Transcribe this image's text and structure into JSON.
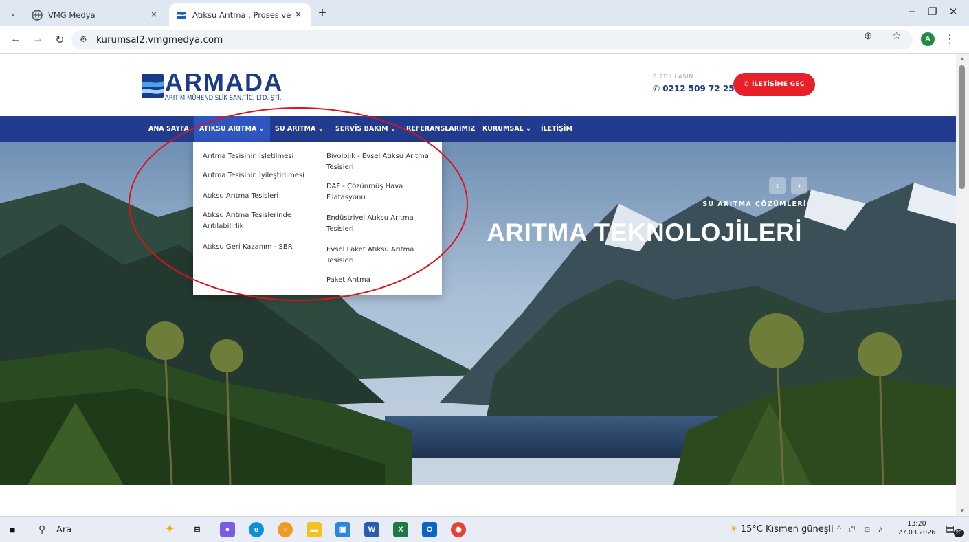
{
  "browser": {
    "tabs": [
      {
        "title": "VMG Medya",
        "close": "×"
      },
      {
        "title": "Atıksu Arıtma , Proses ve İçme S",
        "close": "×"
      }
    ],
    "new_tab": "+",
    "url": "kurumsal2.vmgmedya.com",
    "profile_initial": "A"
  },
  "site": {
    "logo_name": "ARMADA",
    "logo_subtitle": "ARITIM MÜHENDİSLİK SAN.TİC. LTD. ŞTİ.",
    "contact_label": "BİZE ULAŞIN",
    "contact_phone": "0212 509 72 25",
    "cta_label": "İLETİŞİME GEÇ",
    "nav": [
      {
        "label": "ANA SAYFA"
      },
      {
        "label": "ATIKSU ARITMA ⌄"
      },
      {
        "label": "SU ARITMA ⌄"
      },
      {
        "label": "SERVİS BAKIM ⌄"
      },
      {
        "label": "REFERANSLARIMIZ"
      },
      {
        "label": "KURUMSAL ⌄"
      },
      {
        "label": "İLETİŞİM"
      }
    ],
    "dropdown": {
      "left": [
        "Arıtma Tesisinin İşletilmesi",
        "Arıtma Tesisinin İyileştirilmesi",
        "Atıksu Arıtma Tesisleri",
        "Atıksu Arıtma Tesislerinde",
        "Arıtılabilirlik",
        "Atıksu Geri Kazanım - SBR"
      ],
      "right": [
        "Biyolojik - Evsel Atıksu Arıtma",
        "Tesisleri",
        "DAF - Çözünmüş Hava",
        "Filatasyonu",
        "Endüstriyel Atıksu Arıtma",
        "Tesisleri",
        "Evsel Paket Atıksu Arıtma",
        "Tesisleri",
        "Paket Arıtma"
      ]
    },
    "hero": {
      "subtitle": "SU ARITMA ÇÖZÜMLERİ",
      "title": "ARITMA TEKNOLOJİLERİ",
      "prev": "‹",
      "next": "›"
    }
  },
  "taskbar": {
    "search_label": "Ara",
    "weather": "15°C  Kısmen güneşli",
    "time": "13:20",
    "date": "27.03.2026",
    "notifications": "20"
  }
}
